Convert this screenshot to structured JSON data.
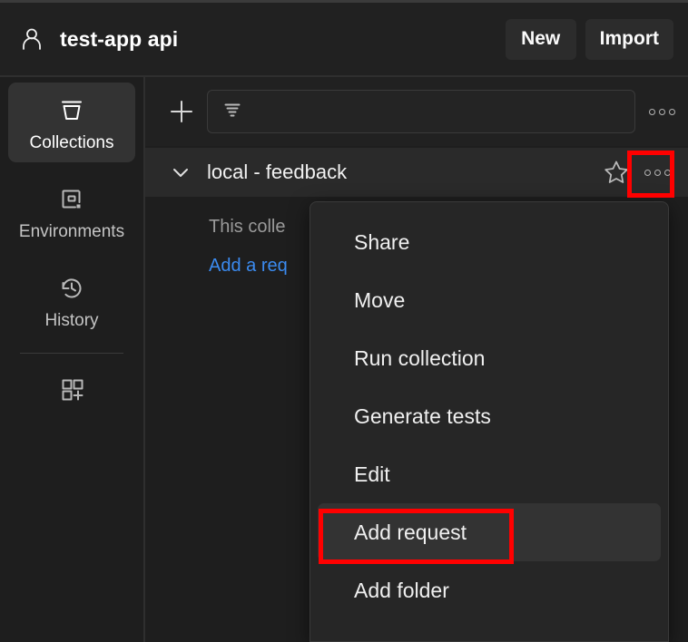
{
  "header": {
    "avatar_icon": "user-avatar-icon",
    "title": "test-app api",
    "buttons": [
      {
        "label": "New",
        "name": "new-button"
      },
      {
        "label": "Import",
        "name": "import-button"
      }
    ]
  },
  "sidebar": {
    "items": [
      {
        "label": "Collections",
        "icon": "collections-icon",
        "active": true
      },
      {
        "label": "Environments",
        "icon": "environments-icon",
        "active": false
      },
      {
        "label": "History",
        "icon": "history-icon",
        "active": false
      }
    ],
    "apps_icon": "apps-grid-plus-icon"
  },
  "toolbar": {
    "add_icon": "plus-icon",
    "filter_icon": "filter-icon",
    "filter_value": "",
    "filter_placeholder": "",
    "more_icon": "more-horizontal-icon"
  },
  "collection": {
    "chevron_icon": "chevron-down-icon",
    "name": "local - feedback",
    "star_icon": "star-outline-icon",
    "more_icon": "more-horizontal-icon"
  },
  "empty_state": {
    "message": "This colle",
    "link": "Add a req"
  },
  "context_menu": {
    "items": [
      {
        "label": "Share",
        "name": "menu-item-share",
        "hovered": false
      },
      {
        "label": "Move",
        "name": "menu-item-move",
        "hovered": false
      },
      {
        "label": "Run collection",
        "name": "menu-item-run-collection",
        "hovered": false
      },
      {
        "label": "Generate tests",
        "name": "menu-item-generate-tests",
        "hovered": false
      },
      {
        "label": "Edit",
        "name": "menu-item-edit",
        "hovered": false
      },
      {
        "label": "Add request",
        "name": "menu-item-add-request",
        "hovered": true
      },
      {
        "label": "Add folder",
        "name": "menu-item-add-folder",
        "hovered": false
      }
    ]
  },
  "annotations": {
    "color": "#ff0000",
    "boxes": [
      {
        "name": "highlight-collection-more-button"
      },
      {
        "name": "highlight-add-request-item"
      }
    ]
  },
  "colors": {
    "app_background": "#1e1e1e",
    "panel_background": "#212121",
    "row_hover": "#2a2a2a",
    "menu_background": "#262626",
    "link_blue": "#3b8bf0",
    "annotation_red": "#ff0000"
  }
}
